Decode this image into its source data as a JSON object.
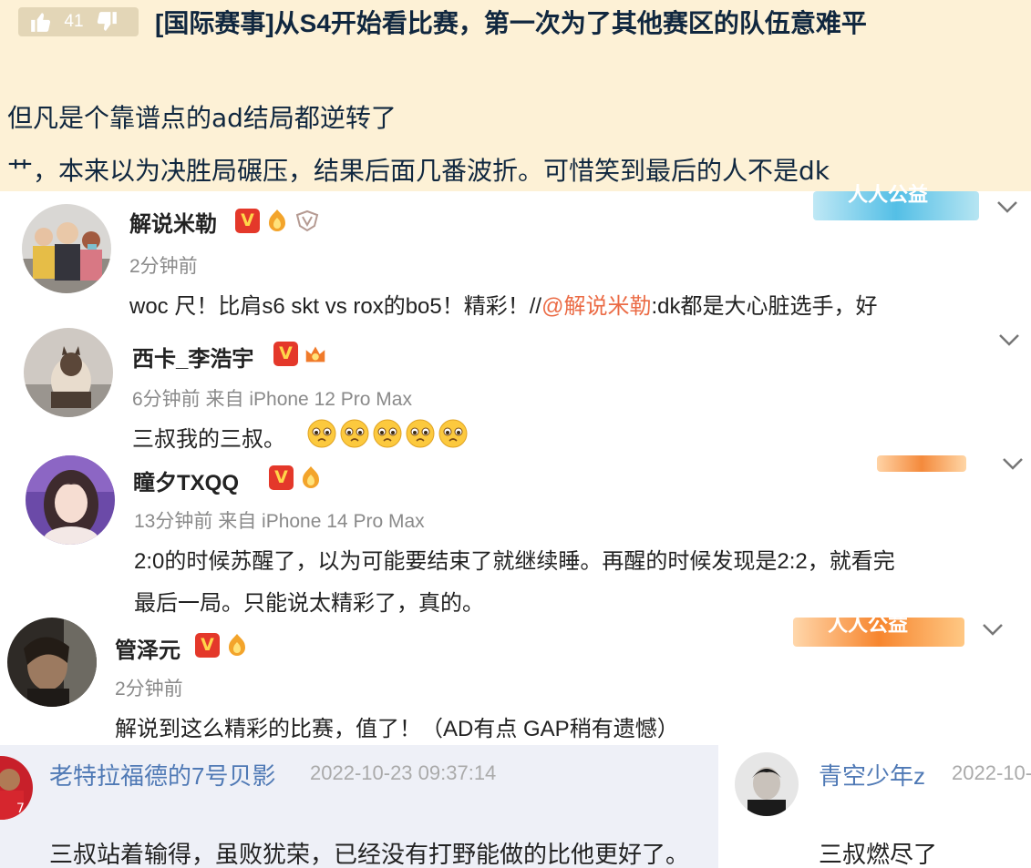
{
  "post": {
    "votes": "41",
    "title": "[国际赛事]从S4开始看比赛，第一次为了其他赛区的队伍意难平",
    "lines": [
      "但凡是个靠谱点的ad结局都逆转了",
      "艹，本来以为决胜局碾压，结果后面几番波折。可惜笑到最后的人不是dk"
    ]
  },
  "comments": [
    {
      "name": "解说米勒",
      "meta": "2分钟前",
      "text_before": "woc 尺！比肩s6 skt vs rox的bo5！精彩！//",
      "mention": "@解说米勒",
      "text_after": ":dk都是大心脏选手，好"
    },
    {
      "name": "西卡_李浩宇",
      "meta": "6分钟前 来自 iPhone 12 Pro Max",
      "text": "三叔我的三叔。"
    },
    {
      "name": "瞳夕TXQQ",
      "meta": "13分钟前 来自 iPhone 14 Pro Max",
      "text_line1": "2:0的时候苏醒了，以为可能要结束了就继续睡。再醒的时候发现是2:2，就看完",
      "text_line2": "最后一局。只能说太精彩了，真的。"
    },
    {
      "name": "管泽元",
      "meta": "2分钟前",
      "text": "解说到这么精彩的比赛，值了！（AD有点 GAP稍有遗憾）"
    }
  ],
  "icons": {
    "verified": "V",
    "charity_label": "人人公益"
  },
  "replies": [
    {
      "name": "老特拉福德的7号贝影",
      "time": "2022-10-23 09:37:14",
      "text": "三叔站着输得，虽败犹荣，已经没有打野能做的比他更好了。"
    },
    {
      "name": "青空少年z",
      "time": "2022-10-",
      "text": "三叔燃尽了"
    }
  ],
  "colors": {
    "header_bg": "#fdf1d6",
    "title": "#10273f",
    "mention": "#eb6b45",
    "reply_name": "#4f79b5",
    "reply_bg": "#eef0f7",
    "vip_red": "#e4382a"
  }
}
